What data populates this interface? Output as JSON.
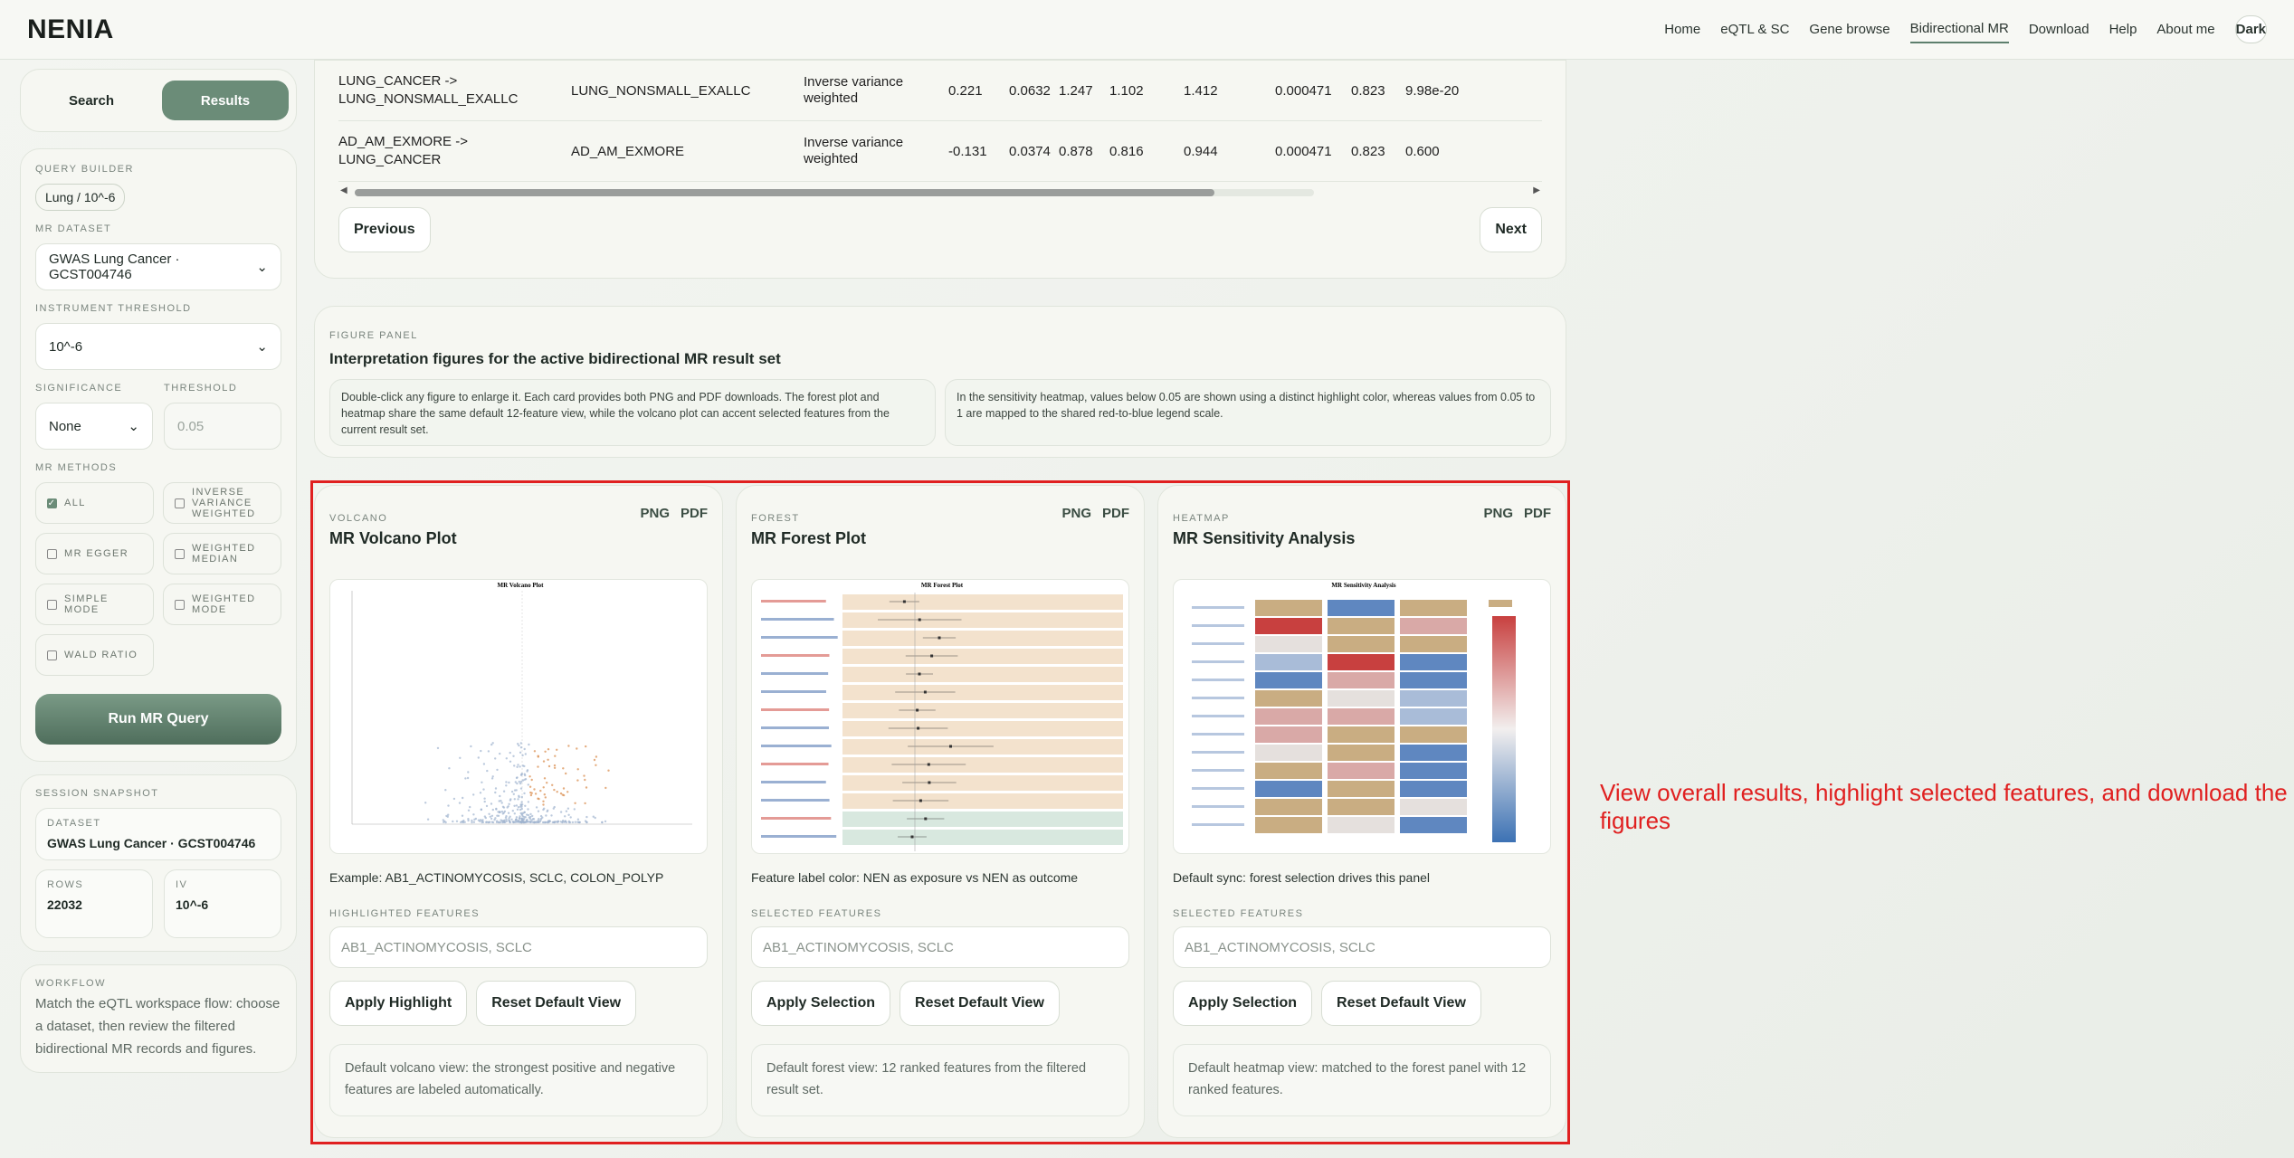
{
  "app": {
    "logo": "NENIA"
  },
  "nav": {
    "items": [
      "Home",
      "eQTL & SC",
      "Gene browse",
      "Bidirectional MR",
      "Download",
      "Help",
      "About me"
    ],
    "theme_button": "Dark"
  },
  "sidebar": {
    "tabs": {
      "search": "Search",
      "results": "Results"
    },
    "query_builder": {
      "label": "QUERY BUILDER",
      "chip": "Lung / 10^-6",
      "dataset_label": "MR DATASET",
      "dataset_value": "GWAS Lung Cancer · GCST004746",
      "threshold_label": "INSTRUMENT THRESHOLD",
      "threshold_value": "10^-6",
      "significance_label": "SIGNIFICANCE",
      "significance_value": "None",
      "p_threshold_label": "THRESHOLD",
      "p_threshold_placeholder": "0.05",
      "methods_label": "MR METHODS",
      "methods": [
        {
          "label": "ALL",
          "checked": true
        },
        {
          "label": "INVERSE VARIANCE WEIGHTED",
          "checked": false
        },
        {
          "label": "MR EGGER",
          "checked": false
        },
        {
          "label": "WEIGHTED MEDIAN",
          "checked": false
        },
        {
          "label": "SIMPLE MODE",
          "checked": false
        },
        {
          "label": "WEIGHTED MODE",
          "checked": false
        },
        {
          "label": "WALD RATIO",
          "checked": false
        }
      ],
      "run_button": "Run MR Query"
    },
    "snapshot": {
      "label": "SESSION SNAPSHOT",
      "dataset_label": "DATASET",
      "dataset_value": "GWAS Lung Cancer · GCST004746",
      "rows_label": "ROWS",
      "rows_value": "22032",
      "iv_label": "IV",
      "iv_value": "10^-6"
    },
    "workflow": {
      "label": "WORKFLOW",
      "text": "Match the eQTL workspace flow: choose a dataset, then review the filtered bidirectional MR records and figures."
    }
  },
  "table": {
    "rows": [
      [
        "LUNG_CANCER -> LUNG_NONSMALL_EXALLC",
        "LUNG_NONSMALL_EXALLC",
        "Inverse variance weighted",
        "0.221",
        "0.0632",
        "1.247",
        "1.102",
        "1.412",
        "0.000471",
        "0.823",
        "9.98e-20"
      ],
      [
        "AD_AM_EXMORE -> LUNG_CANCER",
        "AD_AM_EXMORE",
        "Inverse variance weighted",
        "-0.131",
        "0.0374",
        "0.878",
        "0.816",
        "0.944",
        "0.000471",
        "0.823",
        "0.600"
      ]
    ],
    "prev": "Previous",
    "next": "Next"
  },
  "figure_panel": {
    "label": "FIGURE PANEL",
    "title": "Interpretation figures for the active bidirectional MR result set",
    "note1": "Double-click any figure to enlarge it. Each card provides both PNG and PDF downloads. The forest plot and heatmap share the same default 12-feature view, while the volcano plot can accent selected features from the current result set.",
    "note2": "In the sensitivity heatmap, values below 0.05 are shown using a distinct highlight color, whereas values from 0.05 to 1 are mapped to the shared red-to-blue legend scale."
  },
  "panels": {
    "volcano": {
      "kicker": "VOLCANO",
      "title": "MR Volcano Plot",
      "png": "PNG",
      "pdf": "PDF",
      "plot_title": "MR Volcano Plot",
      "caption": "Example: AB1_ACTINOMYCOSIS, SCLC, COLON_POLYP",
      "input_label": "HIGHLIGHTED FEATURES",
      "input_placeholder": "AB1_ACTINOMYCOSIS, SCLC",
      "apply": "Apply Highlight",
      "reset": "Reset Default View",
      "foot": "Default volcano view: the strongest positive and negative features are labeled automatically."
    },
    "forest": {
      "kicker": "FOREST",
      "title": "MR Forest Plot",
      "png": "PNG",
      "pdf": "PDF",
      "plot_title": "MR Forest Plot",
      "caption": "Feature label color: NEN as exposure vs NEN as outcome",
      "input_label": "SELECTED FEATURES",
      "input_placeholder": "AB1_ACTINOMYCOSIS, SCLC",
      "apply": "Apply Selection",
      "reset": "Reset Default View",
      "foot": "Default forest view: 12 ranked features from the filtered result set."
    },
    "heatmap": {
      "kicker": "HEATMAP",
      "title": "MR Sensitivity Analysis",
      "png": "PNG",
      "pdf": "PDF",
      "plot_title": "MR Sensitivity Analysis",
      "caption": "Default sync: forest selection drives this panel",
      "input_label": "SELECTED FEATURES",
      "input_placeholder": "AB1_ACTINOMYCOSIS, SCLC",
      "apply": "Apply Selection",
      "reset": "Reset Default View",
      "foot": "Default heatmap view: matched to the forest panel with 12 ranked features."
    }
  },
  "annotation": "View overall results, highlight selected features, and download the figures"
}
